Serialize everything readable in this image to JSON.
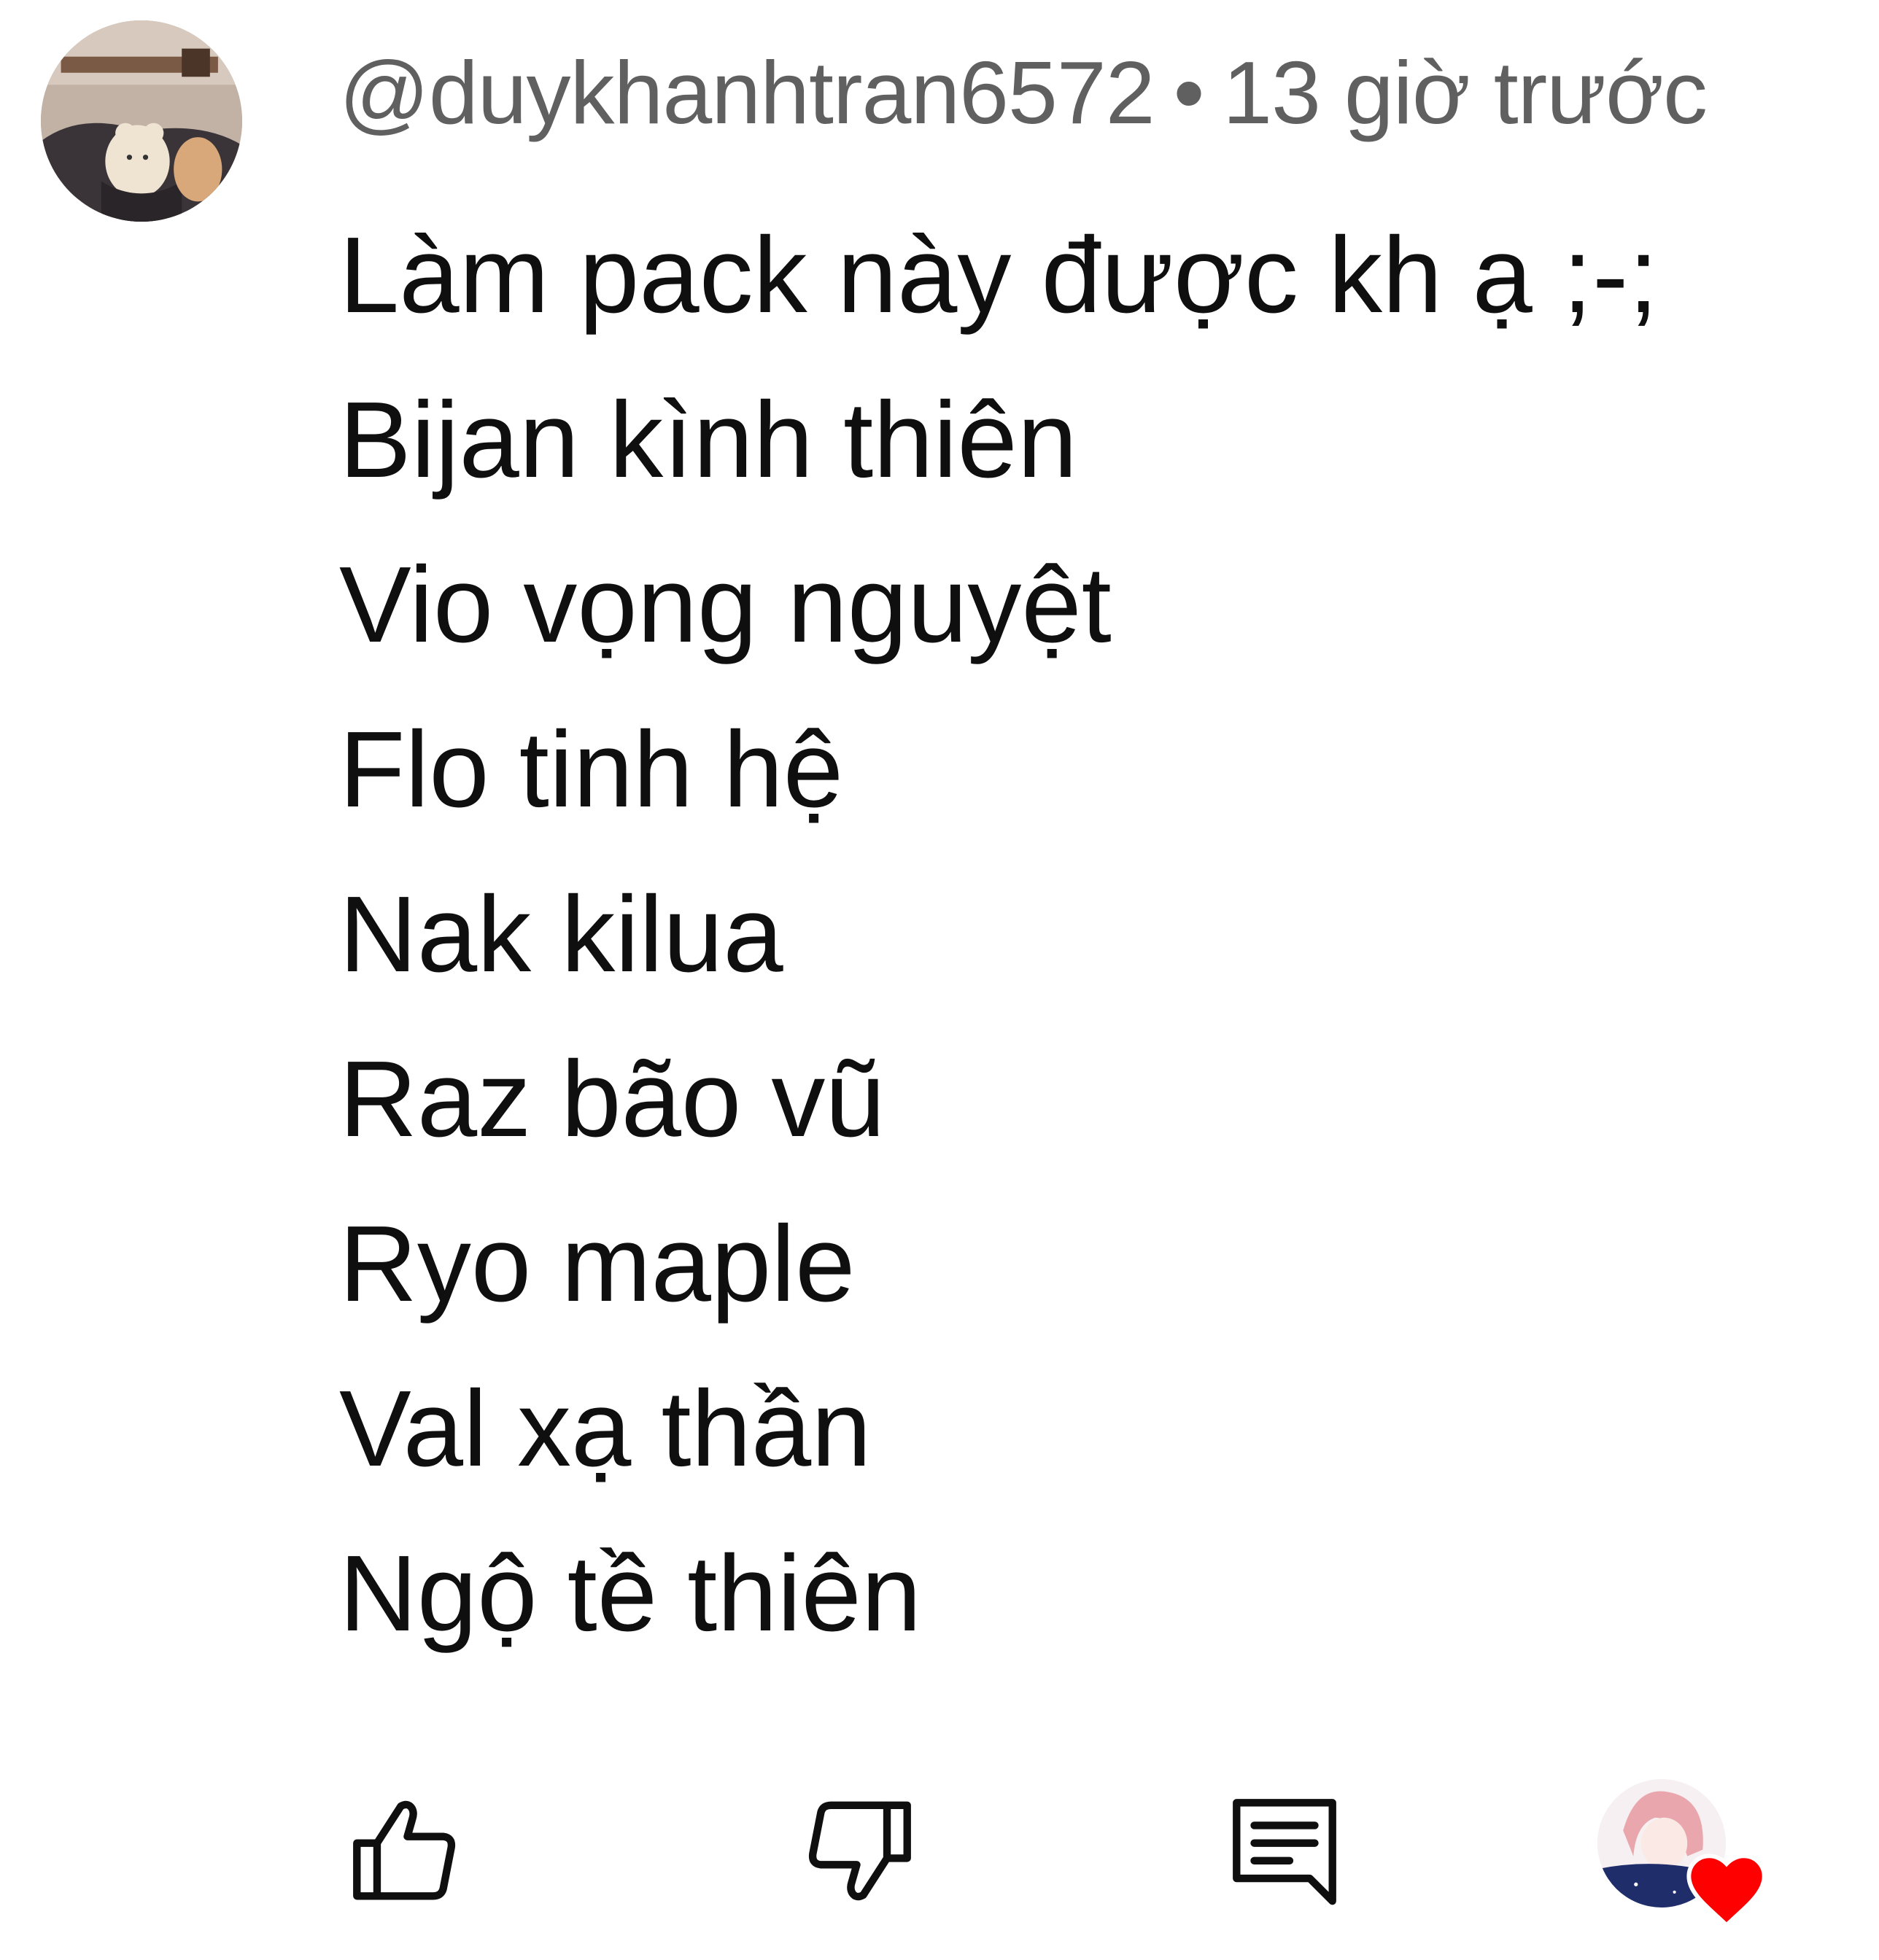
{
  "comment": {
    "username": "@duykhanhtran6572",
    "separator": "•",
    "timestamp": "13 giờ trước",
    "lines": [
      "Làm pack này được kh ạ ;-;",
      "Bijan kình thiên",
      "Vio vọng nguyệt",
      "Flo tinh hệ",
      "Nak kilua",
      "Raz bão vũ",
      "Ryo maple",
      "Val xạ thần",
      "Ngộ tề thiên"
    ]
  },
  "actions": {
    "like_icon": "thumbs-up-icon",
    "dislike_icon": "thumbs-down-icon",
    "reply_icon": "comment-icon",
    "creator_heart_icon": "heart-icon"
  },
  "colors": {
    "text": "#0f0f0f",
    "meta": "#606060",
    "heart": "#ff0000"
  }
}
